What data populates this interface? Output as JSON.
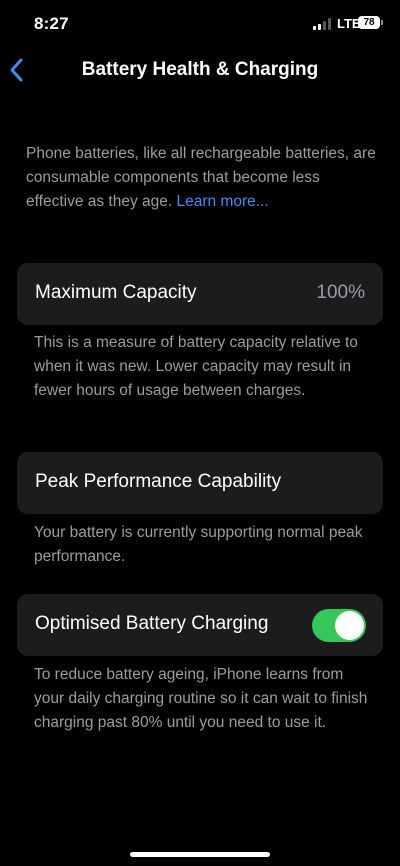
{
  "status_bar": {
    "time": "8:27",
    "network": "LTE",
    "battery_level": "78",
    "signal_bars_active": 2,
    "signal_bars_total": 4
  },
  "nav": {
    "back_icon": "chevron-left-icon",
    "title": "Battery Health & Charging"
  },
  "intro": {
    "text": "Phone batteries, like all rechargeable batteries, are consumable components that become less effective as they age. ",
    "link": "Learn more..."
  },
  "maximum_capacity": {
    "label": "Maximum Capacity",
    "value": "100%",
    "footer": "This is a measure of battery capacity relative to when it was new. Lower capacity may result in fewer hours of usage between charges."
  },
  "peak_performance": {
    "label": "Peak Performance Capability",
    "footer": "Your battery is currently supporting normal peak performance."
  },
  "optimised_charging": {
    "label": "Optimised Battery Charging",
    "enabled": true,
    "footer": "To reduce battery ageing, iPhone learns from your daily charging routine so it can wait to finish charging past 80% until you need to use it."
  },
  "colors": {
    "background": "#000000",
    "cell": "#1c1c1e",
    "secondary_text": "#9c9ca1",
    "link": "#3a8ef5",
    "toggle_on": "#34c759"
  }
}
